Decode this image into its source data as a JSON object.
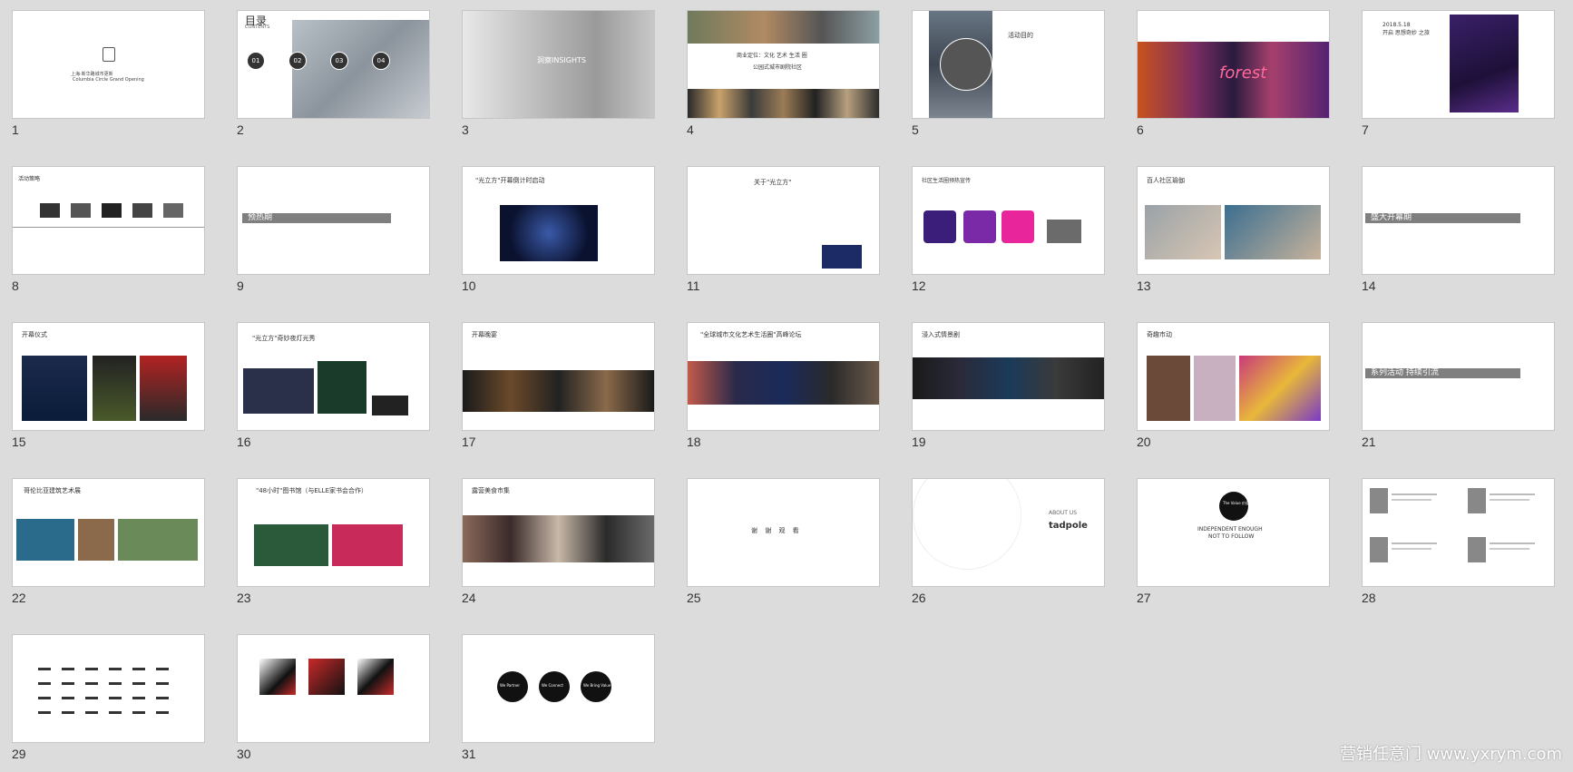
{
  "slides": [
    {
      "n": "1",
      "texts": [
        "上海·新华路城市更新",
        "Columbia Circle Grand Opening"
      ]
    },
    {
      "n": "2",
      "title": "目录",
      "subtitle": "CONTENTS",
      "nums": [
        "01",
        "02",
        "03",
        "04"
      ]
    },
    {
      "n": "3",
      "texts": [
        "洞察INSIGHTS"
      ]
    },
    {
      "n": "4",
      "texts": [
        "商业定位：文化 艺术 生活 圈",
        "公园式城市剧院社区"
      ]
    },
    {
      "n": "5",
      "texts": [
        "活动目的"
      ]
    },
    {
      "n": "6",
      "texts": [
        "forest"
      ]
    },
    {
      "n": "7",
      "texts": [
        "2018.5.18",
        "开启 思想奇妙 之旅"
      ]
    },
    {
      "n": "8",
      "texts": [
        "活动策略"
      ]
    },
    {
      "n": "9",
      "texts": [
        "预热期"
      ]
    },
    {
      "n": "10",
      "texts": [
        "\"光立方\"开幕倒计时启动"
      ]
    },
    {
      "n": "11",
      "texts": [
        "关于\"光立方\""
      ]
    },
    {
      "n": "12",
      "texts": [
        "社区生活圈预热宣传"
      ]
    },
    {
      "n": "13",
      "texts": [
        "百人社区瑜伽"
      ]
    },
    {
      "n": "14",
      "texts": [
        "盛大开幕期"
      ]
    },
    {
      "n": "15",
      "texts": [
        "开幕仪式"
      ]
    },
    {
      "n": "16",
      "texts": [
        "\"光立方\"奇妙夜灯光秀"
      ]
    },
    {
      "n": "17",
      "texts": [
        "开幕晚宴"
      ]
    },
    {
      "n": "18",
      "texts": [
        "\"全球城市文化艺术生活圈\"高峰论坛"
      ]
    },
    {
      "n": "19",
      "texts": [
        "浸入式情景剧"
      ]
    },
    {
      "n": "20",
      "texts": [
        "奇趣市动"
      ]
    },
    {
      "n": "21",
      "texts": [
        "系列活动 持续引流"
      ]
    },
    {
      "n": "22",
      "texts": [
        "哥伦比亚建筑艺术展"
      ]
    },
    {
      "n": "23",
      "texts": [
        "\"48小时\"图书馆（与ELLE家书会合作）"
      ]
    },
    {
      "n": "24",
      "texts": [
        "露营美食市集"
      ]
    },
    {
      "n": "25",
      "texts": [
        "谢 谢 观 看"
      ]
    },
    {
      "n": "26",
      "texts": [
        "ABOUT US",
        "tadpole"
      ]
    },
    {
      "n": "27",
      "texts": [
        "The Value 价值",
        "INDEPENDENT ENOUGH",
        "NOT TO FOLLOW"
      ]
    },
    {
      "n": "28",
      "texts": []
    },
    {
      "n": "29",
      "texts": []
    },
    {
      "n": "30",
      "texts": []
    },
    {
      "n": "31",
      "texts": [
        "We Partner",
        "We Connect",
        "We Bring Value"
      ]
    }
  ],
  "watermark": "营销任意门 www.yxrym.com"
}
